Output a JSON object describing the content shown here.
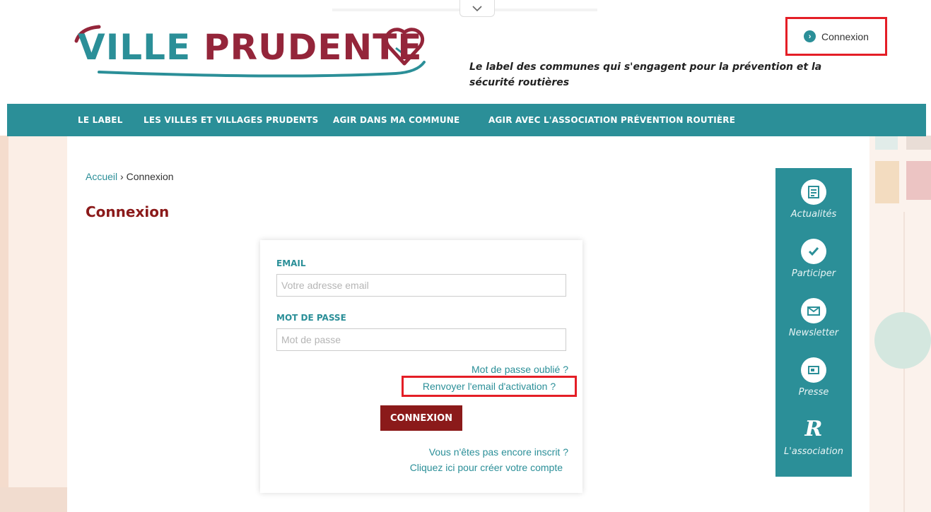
{
  "header": {
    "logo_part1": "VILLE",
    "logo_part2": "PRUDENTE",
    "tagline": "Le label des communes qui s'engagent pour la prévention et la sécurité routières",
    "connexion_label": "Connexion"
  },
  "nav": {
    "items": [
      {
        "label": "LE LABEL"
      },
      {
        "label": "LES VILLES ET VILLAGES PRUDENTS"
      },
      {
        "label": "AGIR DANS MA COMMUNE"
      },
      {
        "label": "AGIR AVEC L'ASSOCIATION PRÉVENTION ROUTIÈRE"
      }
    ]
  },
  "breadcrumb": {
    "home": "Accueil",
    "separator": "›",
    "current": "Connexion"
  },
  "page": {
    "title": "Connexion"
  },
  "form": {
    "email_label": "EMAIL",
    "email_placeholder": "Votre adresse email",
    "password_label": "MOT DE PASSE",
    "password_placeholder": "Mot de passe",
    "forgot_link": "Mot de passe oublié ?",
    "resend_link": "Renvoyer l'email d'activation ?",
    "submit_label": "CONNEXION",
    "signup_question": "Vous n'êtes pas encore inscrit ?",
    "signup_link": "Cliquez ici pour créer votre compte"
  },
  "sidebar": {
    "items": [
      {
        "label": "Actualités",
        "icon": "newspaper-icon"
      },
      {
        "label": "Participer",
        "icon": "check-icon"
      },
      {
        "label": "Newsletter",
        "icon": "envelope-icon"
      },
      {
        "label": "Presse",
        "icon": "press-icon"
      },
      {
        "label": "L'association",
        "icon": "association-r-icon"
      }
    ]
  },
  "colors": {
    "teal": "#2b8f98",
    "maroon": "#8b1a1a",
    "highlight_red": "#e41e26"
  }
}
